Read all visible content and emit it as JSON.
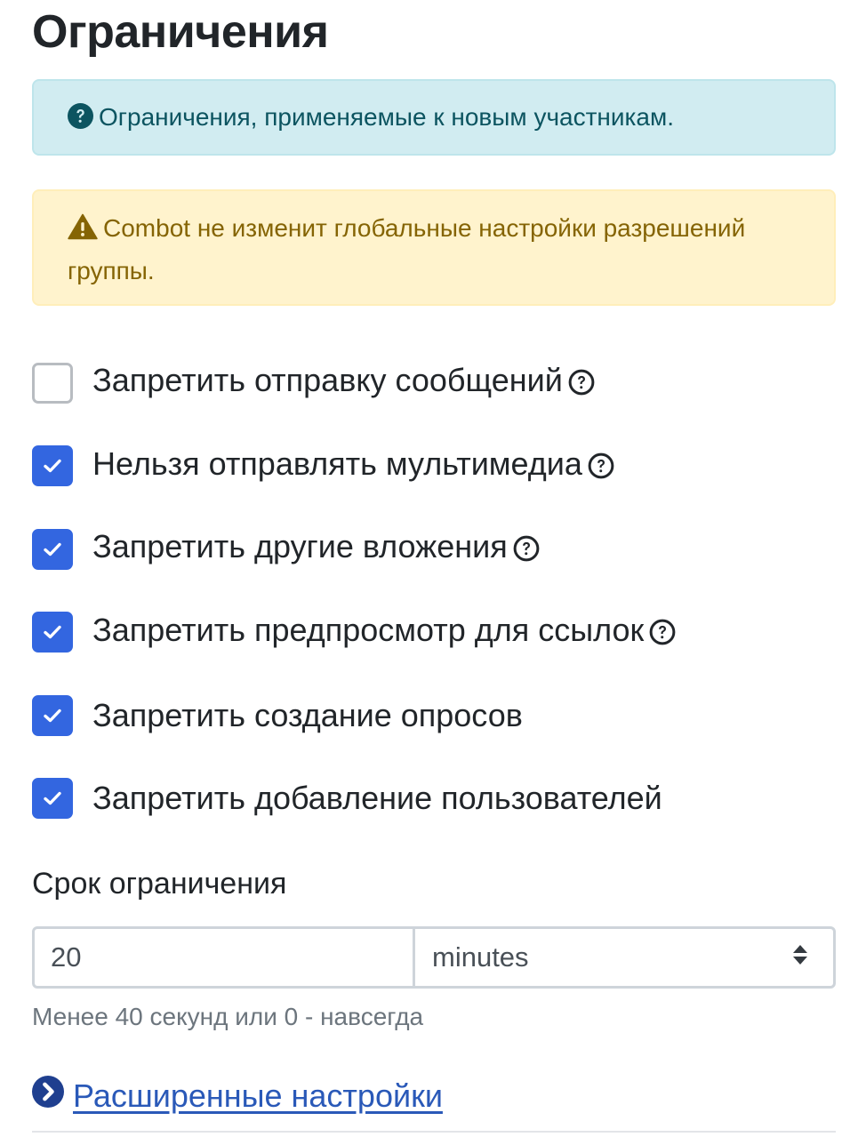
{
  "page_title": "Ограничения",
  "info_alert": {
    "icon": "question-circle-icon",
    "text": "Ограничения, применяемые к новым участникам."
  },
  "warning_alert": {
    "icon": "warning-triangle-icon",
    "text": "Combot не изменит глобальные настройки разрешений группы."
  },
  "restrictions": [
    {
      "label": "Запретить отправку сообщений",
      "checked": false,
      "has_help": true
    },
    {
      "label": "Нельзя отправлять мультимедиа",
      "checked": true,
      "has_help": true
    },
    {
      "label": "Запретить другие вложения",
      "checked": true,
      "has_help": true
    },
    {
      "label": "Запретить предпросмотр для ссылок",
      "checked": true,
      "has_help": true
    },
    {
      "label": "Запретить создание опросов",
      "checked": true,
      "has_help": false
    },
    {
      "label": "Запретить добавление пользователей",
      "checked": true,
      "has_help": false
    }
  ],
  "duration": {
    "label": "Срок ограничения",
    "value": "20",
    "unit": "minutes",
    "hint": "Менее 40 секунд или 0 - навсегда"
  },
  "advanced_link": {
    "label": "Расширенные настройки",
    "icon": "chevron-right-circle-icon"
  },
  "colors": {
    "checkbox_checked": "#3366e0",
    "info_bg": "#d1ecf1",
    "info_text": "#0c5460",
    "warning_bg": "#fff3cd",
    "warning_text": "#856404",
    "link": "#2a59b8"
  }
}
